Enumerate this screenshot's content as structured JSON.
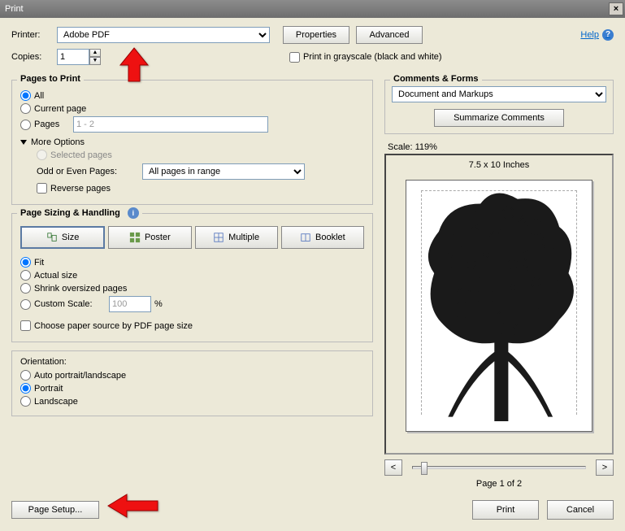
{
  "title": "Print",
  "header": {
    "printer_label": "Printer:",
    "printer_value": "Adobe PDF",
    "properties_btn": "Properties",
    "advanced_btn": "Advanced",
    "help": "Help",
    "copies_label": "Copies:",
    "copies_value": "1",
    "grayscale": "Print in grayscale (black and white)"
  },
  "pages_to_print": {
    "title": "Pages to Print",
    "all": "All",
    "current": "Current page",
    "pages": "Pages",
    "pages_value": "1 - 2",
    "more_options": "More Options",
    "selected_pages": "Selected pages",
    "odd_even_label": "Odd or Even Pages:",
    "odd_even_value": "All pages in range",
    "reverse": "Reverse pages"
  },
  "sizing": {
    "title": "Page Sizing & Handling",
    "tabs": {
      "size": "Size",
      "poster": "Poster",
      "multiple": "Multiple",
      "booklet": "Booklet"
    },
    "fit": "Fit",
    "actual": "Actual size",
    "shrink": "Shrink oversized pages",
    "custom_scale": "Custom Scale:",
    "custom_value": "100",
    "percent": "%",
    "paper_source": "Choose paper source by PDF page size"
  },
  "orientation": {
    "title": "Orientation:",
    "auto": "Auto portrait/landscape",
    "portrait": "Portrait",
    "landscape": "Landscape"
  },
  "comments": {
    "title": "Comments & Forms",
    "value": "Document and Markups",
    "summarize": "Summarize Comments"
  },
  "preview": {
    "scale": "Scale: 119%",
    "dimensions": "7.5 x 10 Inches",
    "prev": "<",
    "next": ">",
    "page_info": "Page 1 of 2"
  },
  "bottom": {
    "page_setup": "Page Setup...",
    "print": "Print",
    "cancel": "Cancel"
  },
  "icons": {
    "close": "×"
  }
}
